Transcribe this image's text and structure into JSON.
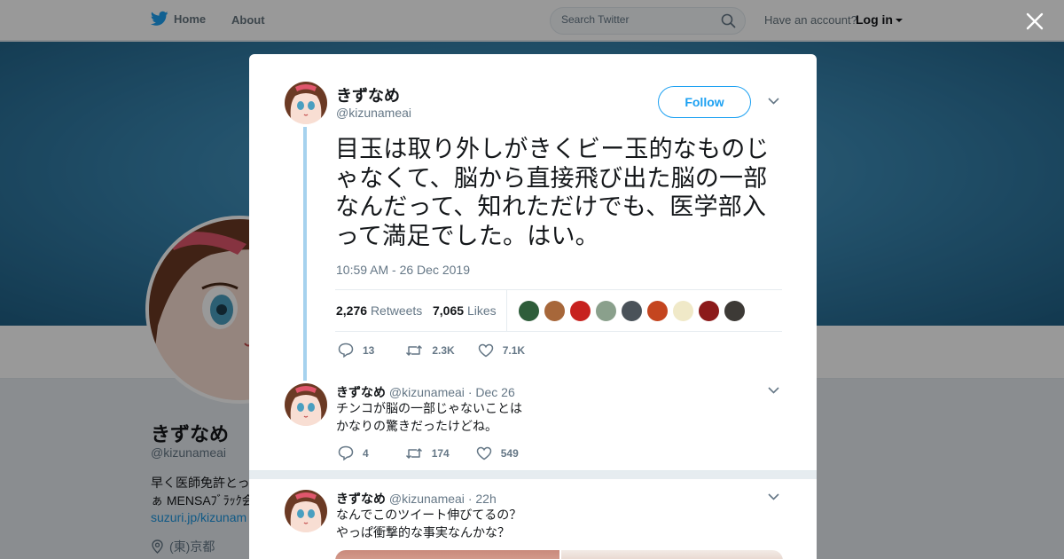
{
  "nav": {
    "home_label": "Home",
    "about_label": "About",
    "search_placeholder": "Search Twitter",
    "account_prompt": "Have an account?",
    "login_label": "Log in"
  },
  "profile": {
    "name": "きずなめ",
    "handle": "@kizunameai",
    "bio_line1": "早く医師免許とっ",
    "bio_line2": "ぁ MENSAﾌﾞﾗｯｸ会",
    "link": "suzuri.jp/kizunam",
    "location": "(東)京都"
  },
  "modal": {
    "tweet": {
      "name": "きずなめ",
      "handle": "@kizunameai",
      "follow_label": "Follow",
      "text": "目玉は取り外しがきくビー玉的なものじゃなくて、脳から直接飛び出た脳の一部なんだって、知れただけでも、医学部入って満足でした。はい。",
      "timestamp": "10:59 AM - 26 Dec 2019",
      "retweets_count": "2,276",
      "retweets_label": "Retweets",
      "likes_count": "7,065",
      "likes_label": "Likes",
      "liker_colors": [
        "#2e5d3a",
        "#a7673a",
        "#c7221f",
        "#8aa08c",
        "#4a5259",
        "#c4451f",
        "#f0e9c8",
        "#8c1a1a",
        "#3d3a36"
      ],
      "actions": {
        "replies": "13",
        "retweets": "2.3K",
        "likes": "7.1K"
      }
    },
    "replies": [
      {
        "name": "きずなめ",
        "handle": "@kizunameai",
        "time": "Dec 26",
        "line1": "チンコが脳の一部じゃないことは",
        "line2": "かなりの驚きだったけどね。",
        "actions": {
          "replies": "4",
          "retweets": "174",
          "likes": "549"
        }
      },
      {
        "name": "きずなめ",
        "handle": "@kizunameai",
        "time": "22h",
        "line1": "なんでこのツイート伸びてるの？",
        "line2": "やっぱ衝撃的な事実なんかな？"
      }
    ]
  },
  "colors": {
    "accent": "#1da1f2",
    "thread_line": "#a6d2ee",
    "muted_text": "#657786"
  }
}
